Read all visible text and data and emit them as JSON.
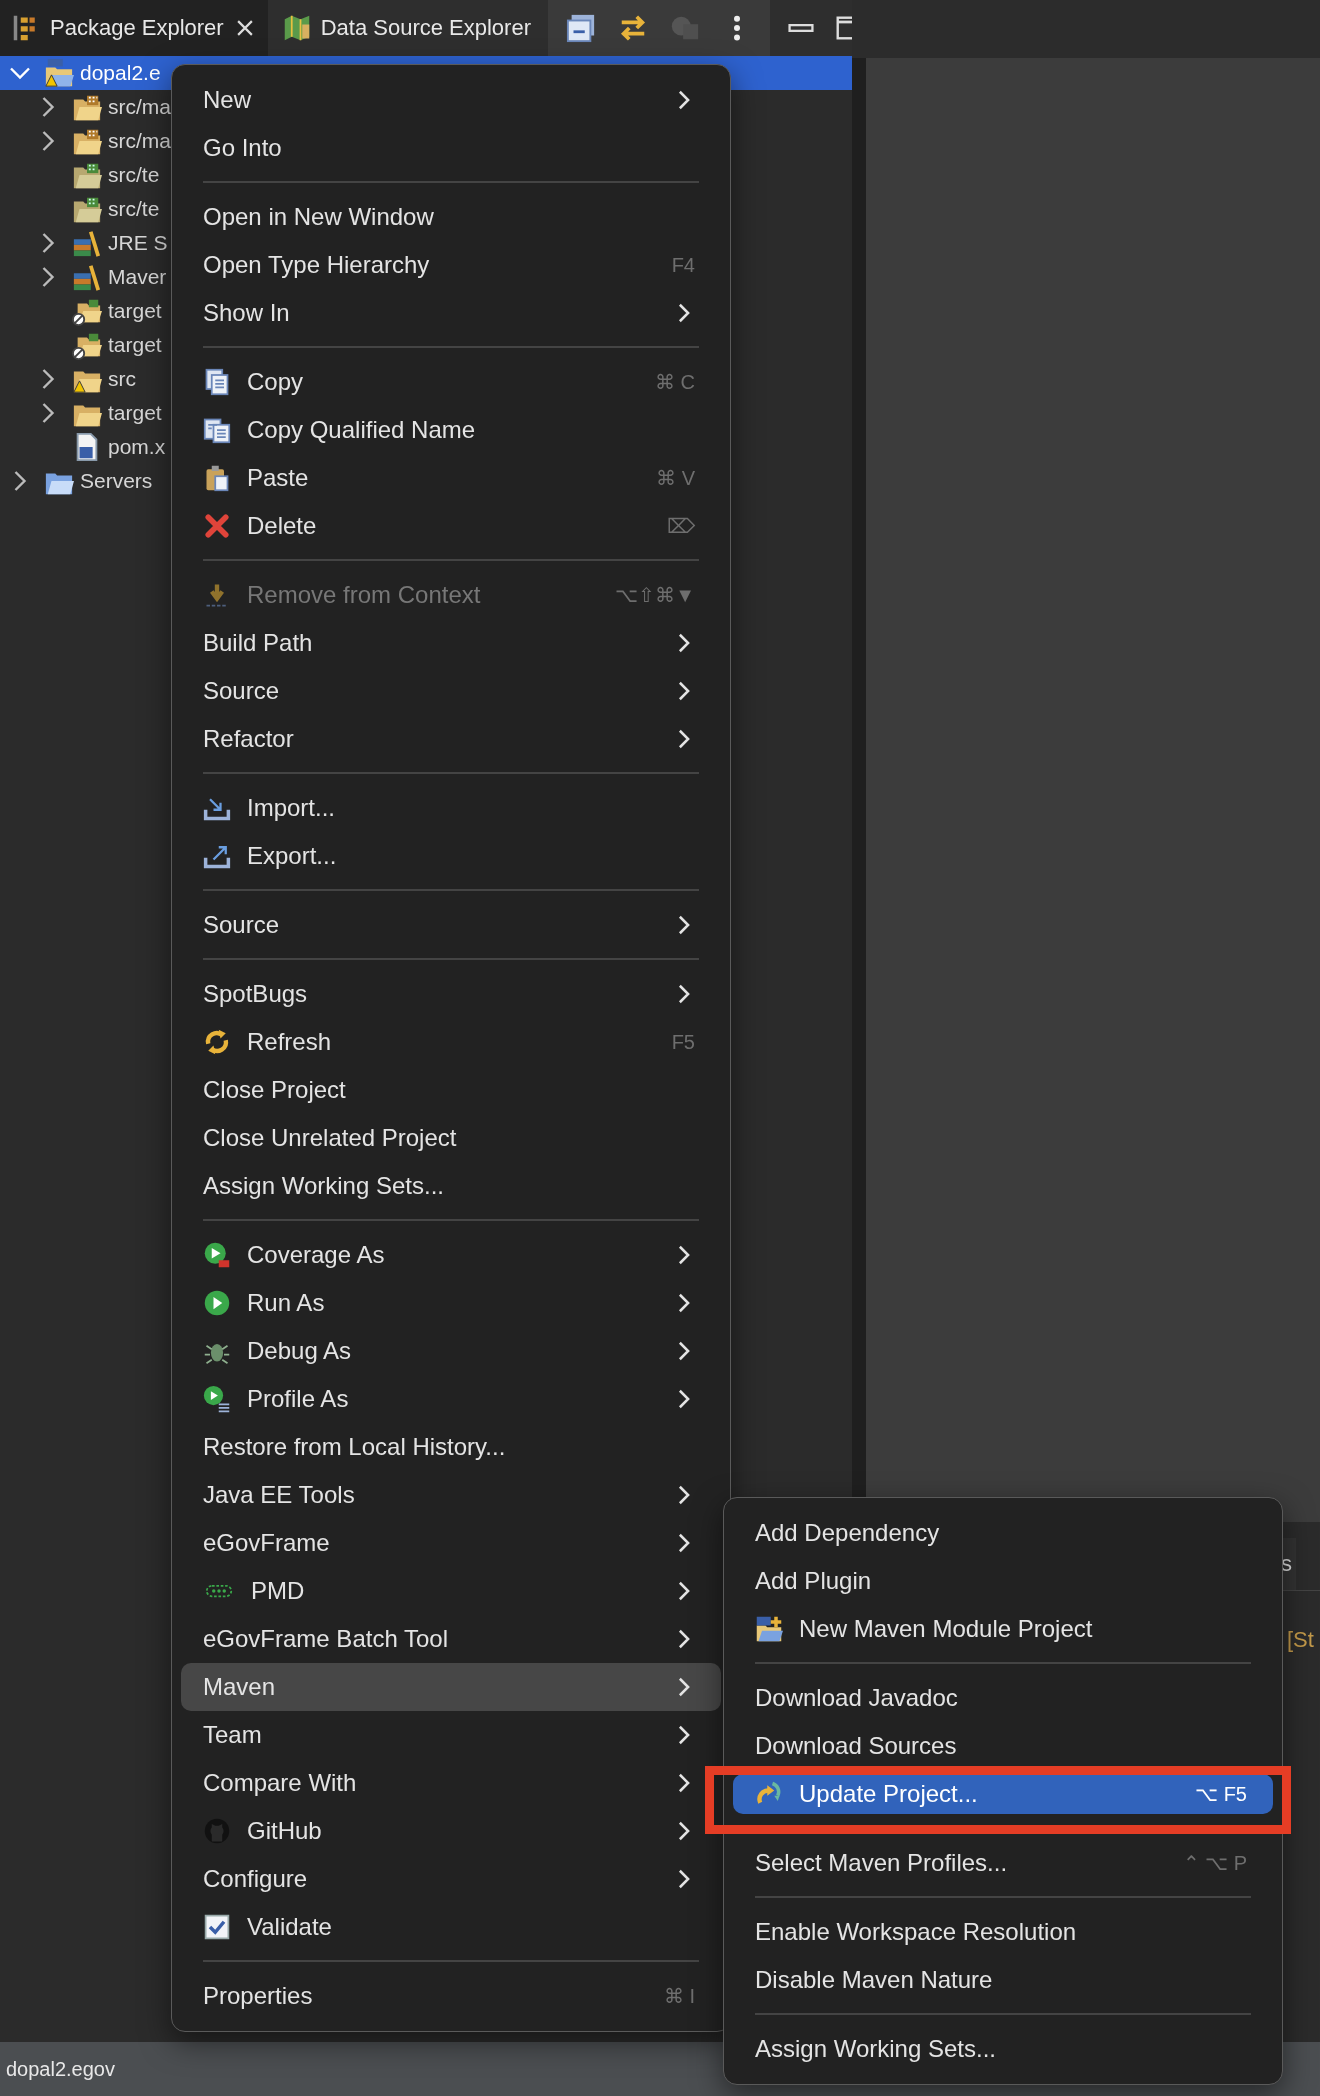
{
  "tabs": [
    {
      "label": "Package Explorer",
      "kind": "package",
      "selected": true,
      "closable": true
    },
    {
      "label": "Data Source Explorer",
      "kind": "datasource",
      "selected": false,
      "closable": false
    }
  ],
  "toolbar": [
    {
      "kind": "collapse",
      "disabled": false
    },
    {
      "kind": "link",
      "disabled": false
    },
    {
      "kind": "filter",
      "disabled": true
    },
    {
      "kind": "more",
      "disabled": false
    }
  ],
  "tree": [
    {
      "label": "dopal2.e",
      "kind": "project",
      "expanded": true,
      "selected": true,
      "children": [
        {
          "label": "src/ma",
          "kind": "package-folder",
          "expanded": false,
          "selected": false
        },
        {
          "label": "src/ma",
          "kind": "package-folder",
          "expanded": false,
          "selected": false
        },
        {
          "label": "src/te",
          "kind": "test-folder",
          "selected": false
        },
        {
          "label": "src/te",
          "kind": "test-folder",
          "selected": false
        },
        {
          "label": "JRE S",
          "kind": "library",
          "expanded": false,
          "selected": false
        },
        {
          "label": "Maver",
          "kind": "library",
          "expanded": false,
          "selected": false
        },
        {
          "label": "target",
          "kind": "excluded-folder",
          "selected": false
        },
        {
          "label": "target",
          "kind": "excluded-folder",
          "selected": false
        },
        {
          "label": "src",
          "kind": "warning-folder",
          "expanded": false,
          "selected": false
        },
        {
          "label": "target",
          "kind": "folder",
          "expanded": false,
          "selected": false
        },
        {
          "label": "pom.x",
          "kind": "pom",
          "selected": false
        }
      ]
    },
    {
      "label": "Servers",
      "kind": "servers",
      "expanded": false,
      "selected": false
    }
  ],
  "context_menu": {
    "items": [
      {
        "kind": "item",
        "label": "New",
        "submenu": true,
        "disabled": false,
        "selected": false
      },
      {
        "kind": "item",
        "label": "Go Into",
        "submenu": false,
        "disabled": false,
        "selected": false
      },
      {
        "kind": "separator"
      },
      {
        "kind": "item",
        "label": "Open in New Window",
        "submenu": false,
        "disabled": false,
        "selected": false
      },
      {
        "kind": "item",
        "label": "Open Type Hierarchy",
        "shortcut": "F4",
        "submenu": false,
        "disabled": false,
        "selected": false
      },
      {
        "kind": "item",
        "label": "Show In",
        "submenu": true,
        "disabled": false,
        "selected": false
      },
      {
        "kind": "separator"
      },
      {
        "kind": "copy",
        "label": "Copy",
        "shortcut": "⌘ C",
        "submenu": false,
        "disabled": false,
        "selected": false
      },
      {
        "kind": "copyname",
        "label": "Copy Qualified Name",
        "submenu": false,
        "disabled": false,
        "selected": false
      },
      {
        "kind": "paste",
        "label": "Paste",
        "shortcut": "⌘ V",
        "submenu": false,
        "disabled": false,
        "selected": false
      },
      {
        "kind": "delete",
        "label": "Delete",
        "shortcut": "⌦",
        "submenu": false,
        "disabled": false,
        "selected": false
      },
      {
        "kind": "separator"
      },
      {
        "kind": "remove",
        "label": "Remove from Context",
        "shortcut": "⌥⇧⌘▼",
        "submenu": false,
        "disabled": true,
        "selected": false
      },
      {
        "kind": "item",
        "label": "Build Path",
        "submenu": true,
        "disabled": false,
        "selected": false
      },
      {
        "kind": "item",
        "label": "Source",
        "submenu": true,
        "disabled": false,
        "selected": false
      },
      {
        "kind": "item",
        "label": "Refactor",
        "submenu": true,
        "disabled": false,
        "selected": false
      },
      {
        "kind": "separator"
      },
      {
        "kind": "import",
        "label": "Import...",
        "submenu": false,
        "disabled": false,
        "selected": false
      },
      {
        "kind": "export",
        "label": "Export...",
        "submenu": false,
        "disabled": false,
        "selected": false
      },
      {
        "kind": "separator"
      },
      {
        "kind": "item",
        "label": "Source",
        "submenu": true,
        "disabled": false,
        "selected": false
      },
      {
        "kind": "separator"
      },
      {
        "kind": "item",
        "label": "SpotBugs",
        "submenu": true,
        "disabled": false,
        "selected": false
      },
      {
        "kind": "refresh",
        "label": "Refresh",
        "shortcut": "F5",
        "submenu": false,
        "disabled": false,
        "selected": false
      },
      {
        "kind": "item",
        "label": "Close Project",
        "submenu": false,
        "disabled": false,
        "selected": false
      },
      {
        "kind": "item",
        "label": "Close Unrelated Project",
        "submenu": false,
        "disabled": false,
        "selected": false
      },
      {
        "kind": "item",
        "label": "Assign Working Sets...",
        "submenu": false,
        "disabled": false,
        "selected": false
      },
      {
        "kind": "separator"
      },
      {
        "kind": "coverage",
        "label": "Coverage As",
        "submenu": true,
        "disabled": false,
        "selected": false
      },
      {
        "kind": "run",
        "label": "Run As",
        "submenu": true,
        "disabled": false,
        "selected": false
      },
      {
        "kind": "debug",
        "label": "Debug As",
        "submenu": true,
        "disabled": false,
        "selected": false
      },
      {
        "kind": "profile",
        "label": "Profile As",
        "submenu": true,
        "disabled": false,
        "selected": false
      },
      {
        "kind": "item",
        "label": "Restore from Local History...",
        "submenu": false,
        "disabled": false,
        "selected": false
      },
      {
        "kind": "item",
        "label": "Java EE Tools",
        "submenu": true,
        "disabled": false,
        "selected": false
      },
      {
        "kind": "item",
        "label": "eGovFrame",
        "submenu": true,
        "disabled": false,
        "selected": false
      },
      {
        "kind": "pmd",
        "label": "PMD",
        "submenu": true,
        "disabled": false,
        "selected": false
      },
      {
        "kind": "item",
        "label": "eGovFrame Batch Tool",
        "submenu": true,
        "disabled": false,
        "selected": false
      },
      {
        "kind": "item",
        "label": "Maven",
        "submenu": true,
        "disabled": false,
        "selected": true
      },
      {
        "kind": "item",
        "label": "Team",
        "submenu": true,
        "disabled": false,
        "selected": false
      },
      {
        "kind": "item",
        "label": "Compare With",
        "submenu": true,
        "disabled": false,
        "selected": false
      },
      {
        "kind": "github",
        "label": "GitHub",
        "submenu": true,
        "disabled": false,
        "selected": false
      },
      {
        "kind": "item",
        "label": "Configure",
        "submenu": true,
        "disabled": false,
        "selected": false
      },
      {
        "kind": "validate",
        "label": "Validate",
        "submenu": false,
        "disabled": false,
        "selected": false
      },
      {
        "kind": "separator"
      },
      {
        "kind": "item",
        "label": "Properties",
        "shortcut": "⌘ I",
        "submenu": false,
        "disabled": false,
        "selected": false
      }
    ]
  },
  "maven_submenu": {
    "items": [
      {
        "kind": "item",
        "label": "Add Dependency",
        "selected": false
      },
      {
        "kind": "item",
        "label": "Add Plugin",
        "selected": false
      },
      {
        "kind": "module",
        "label": "New Maven Module Project",
        "selected": false
      },
      {
        "kind": "separator"
      },
      {
        "kind": "item",
        "label": "Download Javadoc",
        "selected": false
      },
      {
        "kind": "item",
        "label": "Download Sources",
        "selected": false
      },
      {
        "kind": "update",
        "label": "Update Project...",
        "shortcut": "⌥ F5",
        "selected": true,
        "outlined": true
      },
      {
        "kind": "separator"
      },
      {
        "kind": "item",
        "label": "Select Maven Profiles...",
        "shortcut": "⌃ ⌥ P",
        "selected": false
      },
      {
        "kind": "separator"
      },
      {
        "kind": "item",
        "label": "Enable Workspace Resolution",
        "selected": false
      },
      {
        "kind": "item",
        "label": "Disable Maven Nature",
        "selected": false
      },
      {
        "kind": "separator"
      },
      {
        "kind": "item",
        "label": "Assign Working Sets...",
        "selected": false
      }
    ]
  },
  "bottom_panel": {
    "tab": "s",
    "console_text": "[St"
  },
  "status_bar": {
    "text": "dopal2.egov"
  }
}
